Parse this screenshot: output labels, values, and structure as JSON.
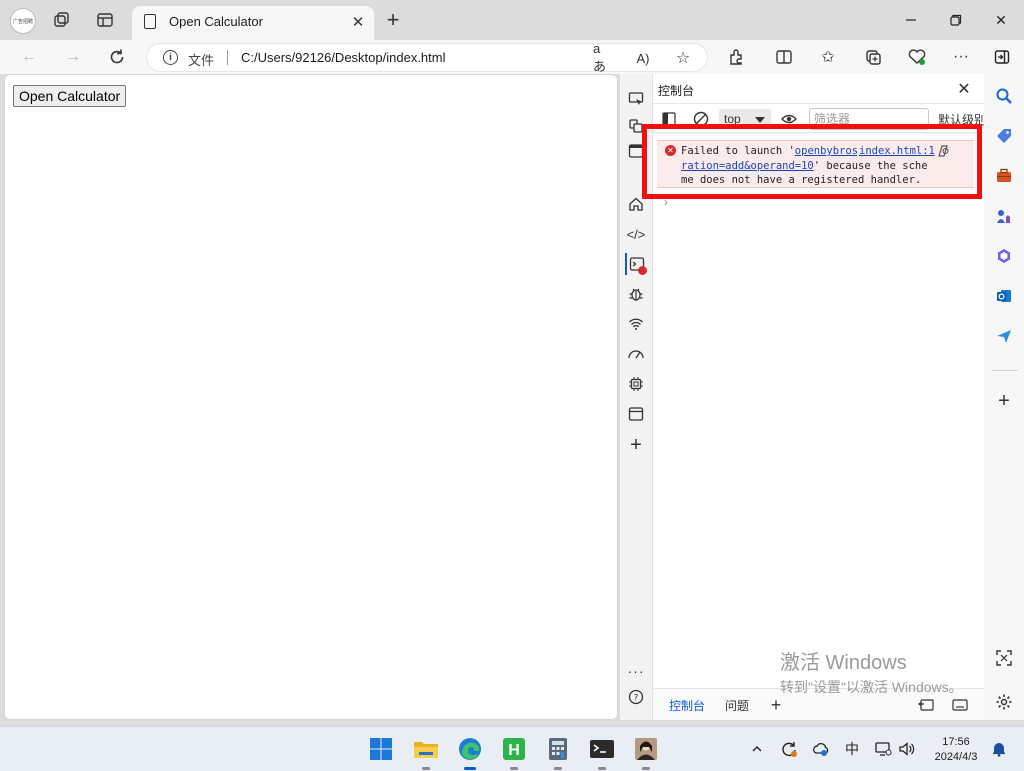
{
  "browser": {
    "profile_label": "广告招聘",
    "tab": {
      "title": "Open Calculator"
    },
    "address": {
      "scheme_label": "文件",
      "url": "C:/Users/92126/Desktop/index.html"
    }
  },
  "page": {
    "button_label": "Open Calculator"
  },
  "devtools": {
    "panel_title": "控制台",
    "context": "top",
    "filter_placeholder": "筛选器",
    "levels_label": "默认级别",
    "error": {
      "prefix": "Failed to launch '",
      "link": "openbybros wer://?operation=add&operand=10",
      "suffix": "' because the scheme does not have a registered handler.",
      "source": "index.html:1"
    },
    "footer_tabs": [
      "控制台",
      "问题"
    ]
  },
  "watermark": {
    "line1": "激活 Windows",
    "line2": "转到\"设置\"以激活 Windows。"
  },
  "taskbar": {
    "ime": "中",
    "time": "17:56",
    "date": "2024/4/3"
  },
  "colors": {
    "accent": "#0b5cd5",
    "error": "#d82a2a",
    "highlight": "#f01010"
  }
}
